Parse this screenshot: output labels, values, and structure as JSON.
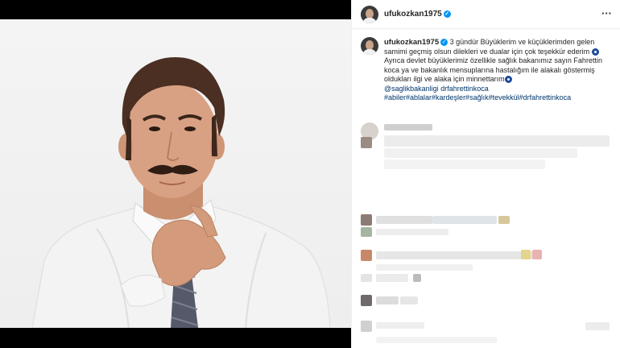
{
  "post": {
    "username": "ufukozkan1975",
    "more_icon": "more-horizontal-icon",
    "verified_icon": "verified-badge-icon"
  },
  "caption": {
    "username": "ufukozkan1975",
    "line1": "3 gündür Büyüklerim ve küçüklerimden gelen samimi geçmiş olsun dilekleri ve dualar için çok teşekkür ederim",
    "line2": "Ayrıca devlet büyüklerimiz özellikle sağlık bakanımız sayın Fahrettin koca ya ve bakanlık mensuplarına hastalığım ile alakalı göstermiş oldukları ilgi ve alaka için minnettarım",
    "mentions": [
      "@saglikbakanligi",
      "drfahrettinkoca"
    ],
    "hashtags": "#abiler#ablalar#kardeşler#sağlık#tevekkül#drfahrettinkoca"
  },
  "colors": {
    "link": "#00376b",
    "verified": "#0095f6",
    "nazar": "#1c4a9a"
  }
}
